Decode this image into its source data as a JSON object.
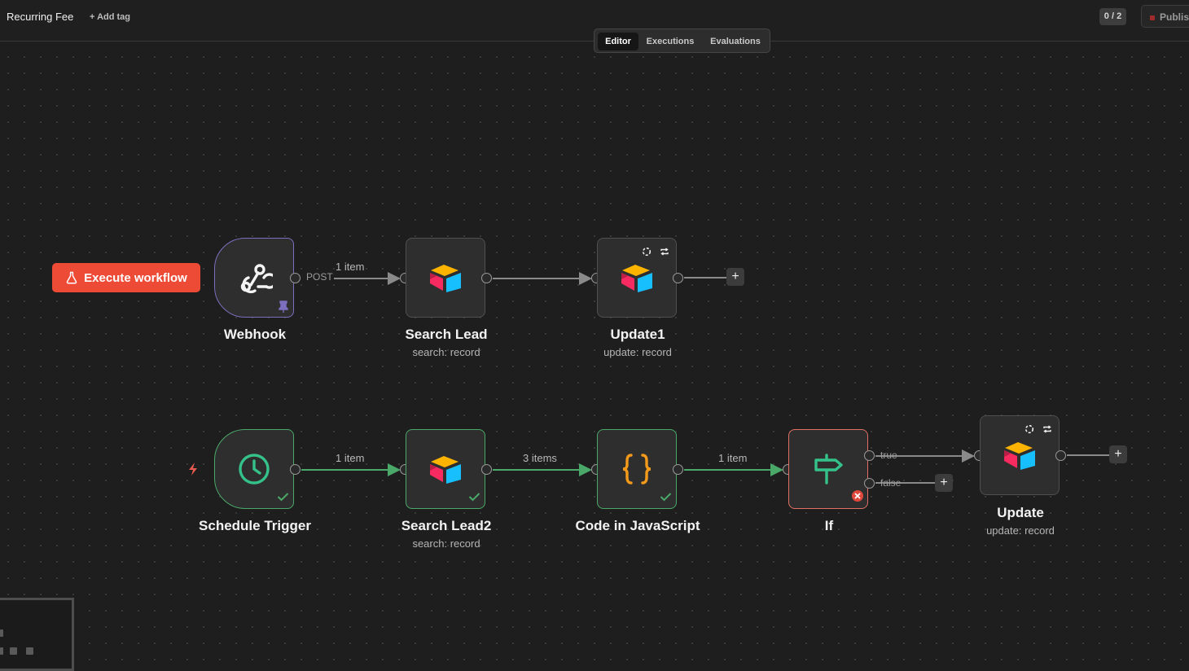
{
  "header": {
    "workflow_name": "Recurring Fee",
    "add_tag": "+ Add tag",
    "counter": "0 / 2",
    "publish_label": "Publish"
  },
  "tabs": [
    {
      "label": "Editor",
      "active": true
    },
    {
      "label": "Executions",
      "active": false
    },
    {
      "label": "Evaluations",
      "active": false
    }
  ],
  "execute_button": {
    "label": "Execute workflow",
    "icon": "flask-icon"
  },
  "nodes": {
    "webhook": {
      "title": "Webhook",
      "subtitle": "",
      "icon": "webhook-icon",
      "output_label": "POST"
    },
    "search_lead": {
      "title": "Search Lead",
      "subtitle": "search: record",
      "icon": "airtable-icon"
    },
    "update1": {
      "title": "Update1",
      "subtitle": "update: record",
      "icon": "airtable-icon"
    },
    "schedule_trigger": {
      "title": "Schedule Trigger",
      "subtitle": "",
      "icon": "clock-icon",
      "status": "success"
    },
    "search_lead2": {
      "title": "Search Lead2",
      "subtitle": "search: record",
      "icon": "airtable-icon",
      "status": "success"
    },
    "code_js": {
      "title": "Code in JavaScript",
      "subtitle": "",
      "icon": "code-braces-icon",
      "status": "success"
    },
    "if": {
      "title": "If",
      "subtitle": "",
      "icon": "signpost-icon",
      "status": "error",
      "true_label": "true",
      "false_label": "false"
    },
    "update": {
      "title": "Update",
      "subtitle": "update: record",
      "icon": "airtable-icon"
    }
  },
  "edges": {
    "webhook_to_search": "1 item",
    "schedule_to_search2": "1 item",
    "search2_to_code": "3 items",
    "code_to_if": "1 item"
  },
  "colors": {
    "accent": "#ee4b36",
    "success": "#4aa968",
    "error": "#e07065",
    "webhook_border": "#7c6fbf",
    "code_icon": "#f39a1b"
  }
}
